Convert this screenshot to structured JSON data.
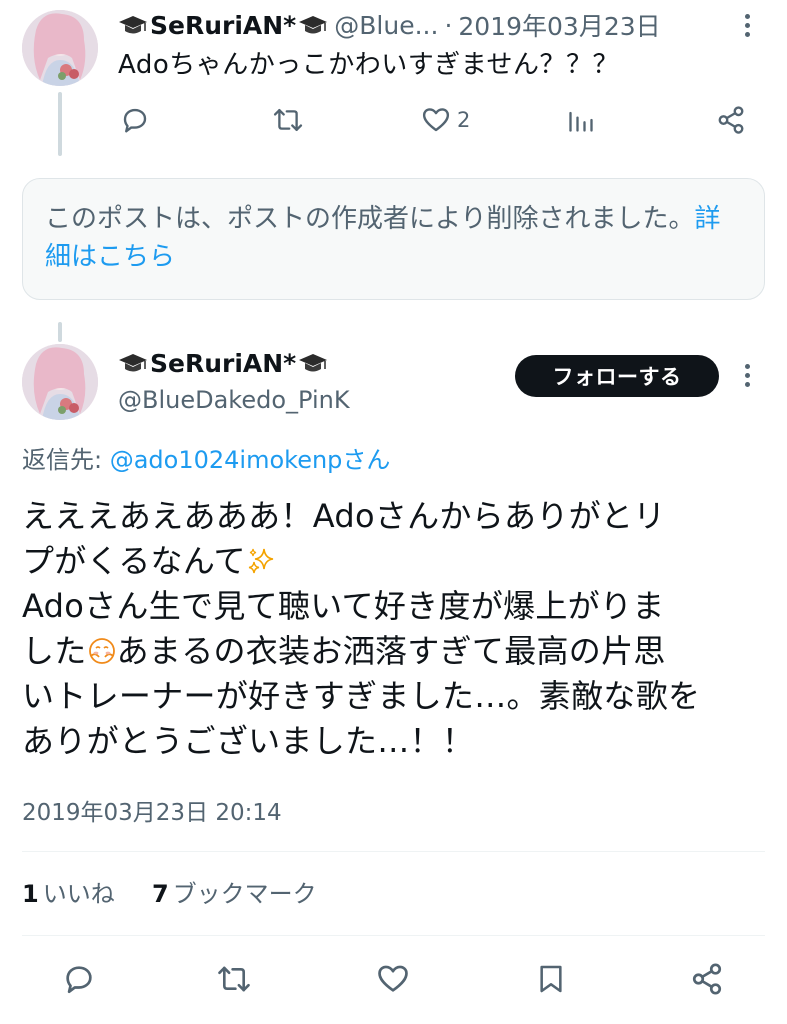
{
  "thread": {
    "tweet1": {
      "display_name": "SeRuriAN*",
      "handle_truncated": "@Blue...",
      "separator": "·",
      "date": "2019年03月23日",
      "text": "Adoちゃんかっこかわいすぎません？？？",
      "likes": "2"
    },
    "deleted_notice": {
      "text": "このポストは、ポストの作成者により削除されました。",
      "link": "詳細はこちら"
    },
    "main_tweet": {
      "display_name": "SeRuriAN*",
      "handle": "@BlueDakedo_PinK",
      "follow_label": "フォローする",
      "reply_label": "返信先: ",
      "reply_mention": "@ado1024imokenpさん",
      "body_lines": [
        "えええあえあああ！Adoさんからありがとリ",
        "プがくるなんて",
        "Adoさん生で見て聴いて好き度が爆上がりま",
        "した",
        "あまるの衣装お洒落すぎて最高の片思",
        "いトレーナーが好きすぎました…。素敵な歌を",
        "ありがとうございました…！！"
      ],
      "timestamp": "2019年03月23日 20:14",
      "likes_count": "1",
      "likes_label": "いいね",
      "bookmarks_count": "7",
      "bookmarks_label": "ブックマーク"
    }
  },
  "icons": [
    "graduation-cap-icon",
    "reply-icon",
    "retweet-icon",
    "heart-icon",
    "analytics-icon",
    "share-icon",
    "bookmark-icon",
    "more-icon",
    "sparkles-icon",
    "blushing-face-icon"
  ],
  "colors": {
    "link": "#1d9bf0",
    "secondary_text": "#536471",
    "primary_text": "#0f1419",
    "follow_button_bg": "#0f1419"
  }
}
